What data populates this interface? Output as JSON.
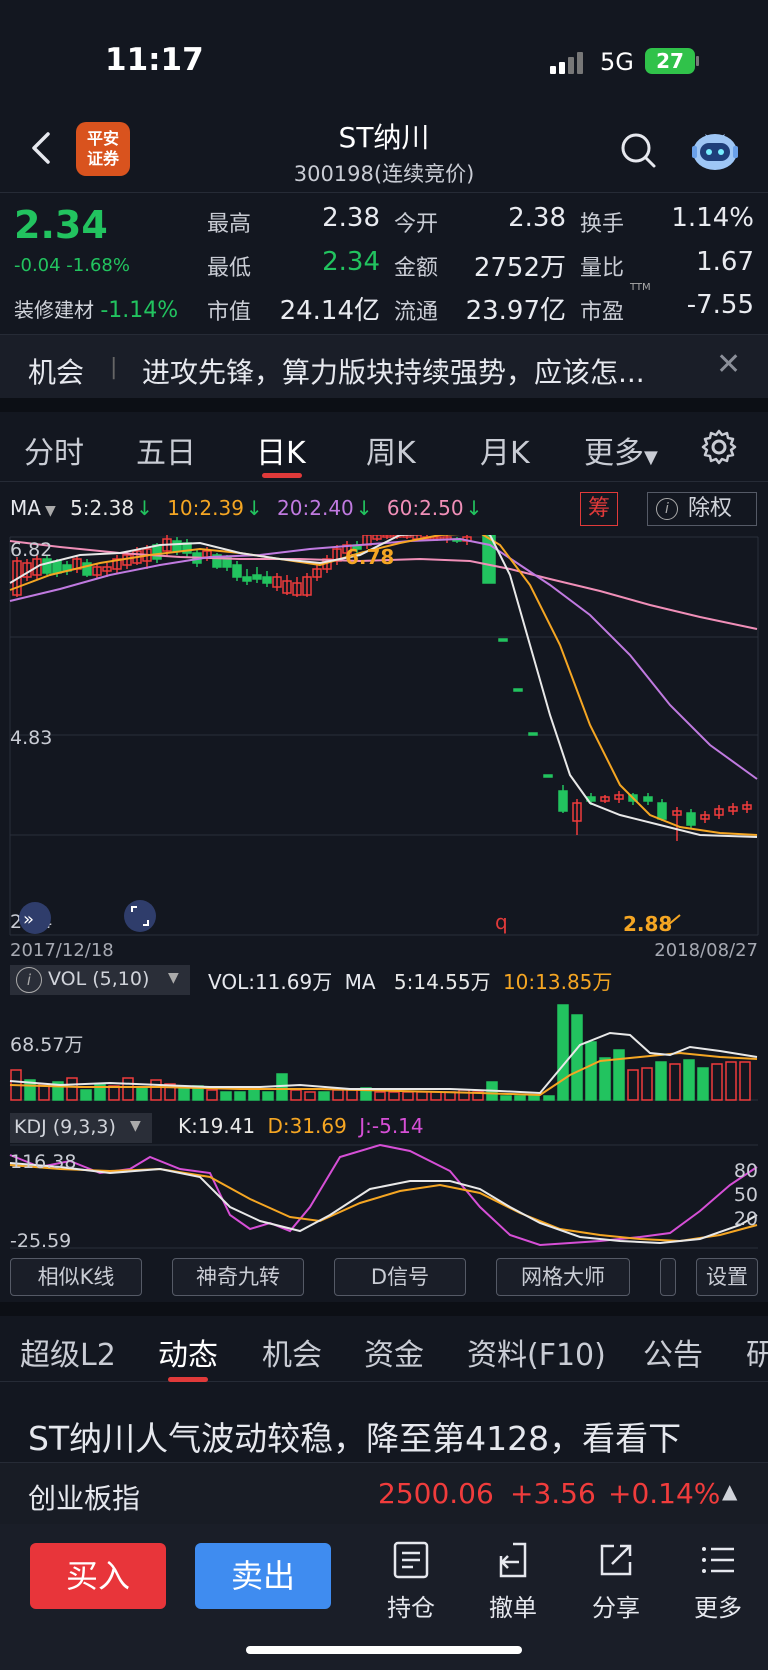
{
  "status": {
    "time": "11:17",
    "network": "5G",
    "battery": "27"
  },
  "header": {
    "broker_logo_line1": "平安",
    "broker_logo_line2": "证券",
    "title": "ST纳川",
    "subtitle": "300198(连续竞价)"
  },
  "quote": {
    "price": "2.34",
    "change": "-0.04 -1.68%",
    "sector_name": "装修建材",
    "sector_change": "-1.14%",
    "high_label": "最高",
    "high": "2.38",
    "low_label": "最低",
    "low": "2.34",
    "mcap_label": "市值",
    "mcap": "24.14亿",
    "open_label": "今开",
    "open": "2.38",
    "amount_label": "金额",
    "amount": "2752万",
    "float_label": "流通",
    "float": "23.97亿",
    "turnover_label": "换手",
    "turnover": "1.14%",
    "vratio_label": "量比",
    "vratio": "1.67",
    "pe_label": "市盈",
    "pe_sup": "TTM",
    "pe": "-7.55"
  },
  "news": {
    "tag": "机会",
    "text": "进攻先锋，算力版块持续强势，应该怎..."
  },
  "ktabs": [
    "分时",
    "五日",
    "日K",
    "周K",
    "月K",
    "更多"
  ],
  "ma": {
    "label": "MA",
    "ma5": "5:2.38",
    "ma10": "10:2.39",
    "ma20": "20:2.40",
    "ma60": "60:2.50",
    "chou": "筹",
    "chuquan": "除权"
  },
  "colors": {
    "up": "#f03c3c",
    "down": "#22c35f",
    "ma5": "#e8e8e8",
    "ma10": "#f5a623",
    "ma20": "#c07ae0",
    "ma60": "#f08fb8",
    "accent": "#e03a3a"
  },
  "kline": {
    "y_top": "6.82",
    "y_mid": "4.83",
    "y_bottom": "2.84",
    "high_mark": "6.78",
    "low_mark": "2.88",
    "date_start": "2017/12/18",
    "date_end": "2018/08/27",
    "q_mark": "q"
  },
  "vol": {
    "label": "VOL (5,10)",
    "vol": "VOL:11.69万",
    "ma": "MA",
    "ma5": "5:14.55万",
    "ma10": "10:13.85万",
    "axis": "68.57万"
  },
  "kdj": {
    "label": "KDJ (9,3,3)",
    "k": "K:19.41",
    "d": "D:31.69",
    "j": "J:-5.14",
    "top": "116.38",
    "bottom": "-25.59",
    "l80": "80",
    "l50": "50",
    "l20": "20"
  },
  "tools": [
    "相似K线",
    "神奇九转",
    "D信号",
    "网格大师",
    "设置"
  ],
  "ftabs": [
    "超级L2",
    "动态",
    "机会",
    "资金",
    "资料(F10)",
    "公告",
    "研"
  ],
  "headline": "ST纳川人气波动较稳，降至第4128，看看下",
  "index": {
    "name": "创业板指",
    "value": "2500.06",
    "change": "+3.56",
    "pct": "+0.14%"
  },
  "bottom": {
    "buy": "买入",
    "sell": "卖出",
    "hold": "持仓",
    "cancel": "撤单",
    "share": "分享",
    "more": "更多"
  }
}
